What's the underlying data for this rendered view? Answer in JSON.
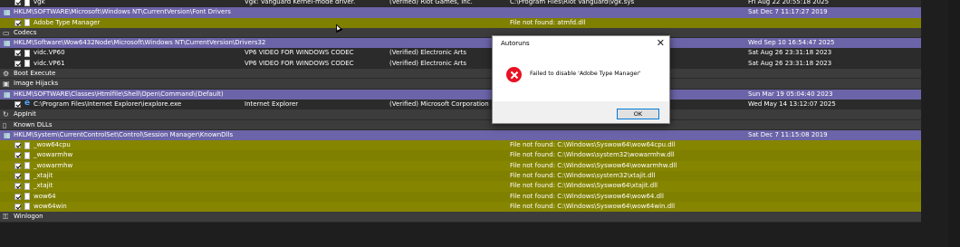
{
  "rows": [
    {
      "type": "entry",
      "icon": "file-icon",
      "name": "vgk",
      "desc": "Vgk: Vanguard Kernel-mode driver.",
      "pub": "(Verified) Riot Games, Inc.",
      "path": "C:\\Program Files\\Riot Vanguard\\vgk.sys",
      "time": "Fri Aug 22 20:55:18 2025"
    },
    {
      "type": "key",
      "name": "HKLM\\SOFTWARE\\Microsoft\\Windows NT\\CurrentVersion\\Font Drivers",
      "time": "Sat Dec  7 11:17:27 2019"
    },
    {
      "type": "nf",
      "name": "Adobe Type Manager",
      "path": "File not found: atmfd.dll"
    },
    {
      "type": "cat",
      "icon": "codecs-icon",
      "name": "Codecs"
    },
    {
      "type": "key",
      "name": "HKLM\\Software\\Wow6432Node\\Microsoft\\Windows NT\\CurrentVersion\\Drivers32",
      "time": "Wed Sep 10 16:54:47 2025"
    },
    {
      "type": "entry",
      "name": "vidc.VP60",
      "desc": "VP6 VIDEO FOR WINDOWS CODEC",
      "pub": "(Verified) Electronic Arts",
      "time": "Sat Aug 26 23:31:18 2023"
    },
    {
      "type": "entry",
      "name": "vidc.VP61",
      "desc": "VP6 VIDEO FOR WINDOWS CODEC",
      "pub": "(Verified) Electronic Arts",
      "time": "Sat Aug 26 23:31:18 2023"
    },
    {
      "type": "cat",
      "icon": "boot-execute-icon",
      "name": "Boot Execute"
    },
    {
      "type": "cat",
      "icon": "image-hijacks-icon",
      "name": "Image Hijacks"
    },
    {
      "type": "key",
      "name": "HKLM\\SOFTWARE\\Classes\\Htmlfile\\Shell\\Open\\Command\\(Default)",
      "time": "Sun Mar 19 05:04:40 2023"
    },
    {
      "type": "entry",
      "ie": true,
      "name": "C:\\Program Files\\Internet Explorer\\iexplore.exe",
      "desc": "Internet Explorer",
      "pub": "(Verified) Microsoft Corporation",
      "time": "Wed May 14 13:12:07 2025"
    },
    {
      "type": "cat",
      "icon": "appinit-icon",
      "name": "AppInit"
    },
    {
      "type": "cat",
      "icon": "known-dlls-icon",
      "name": "Known DLLs"
    },
    {
      "type": "key",
      "name": "HKLM\\System\\CurrentControlSet\\Control\\Session Manager\\KnownDlls",
      "time": "Sat Dec  7 11:15:08 2019"
    },
    {
      "type": "nf",
      "name": "_wow64cpu",
      "path": "File not found: C:\\Windows\\Syswow64\\wow64cpu.dll"
    },
    {
      "type": "nf",
      "name": "_wowarmhw",
      "path": "File not found: C:\\Windows\\system32\\wowarmhw.dll"
    },
    {
      "type": "nf",
      "name": "_wowarmhw",
      "path": "File not found: C:\\Windows\\Syswow64\\wowarmhw.dll"
    },
    {
      "type": "nf",
      "name": "_xtajit",
      "path": "File not found: C:\\Windows\\system32\\xtajit.dll"
    },
    {
      "type": "nf",
      "name": "_xtajit",
      "path": "File not found: C:\\Windows\\Syswow64\\xtajit.dll"
    },
    {
      "type": "nf",
      "name": "wow64",
      "path": "File not found: C:\\Windows\\Syswow64\\wow64.dll"
    },
    {
      "type": "nf",
      "name": "wow64win",
      "path": "File not found: C:\\Windows\\Syswow64\\wow64win.dll"
    },
    {
      "type": "cat",
      "icon": "winlogon-icon",
      "name": "Winlogon"
    }
  ],
  "dialog": {
    "title": "Autoruns",
    "message": "Failed to disable 'Adobe Type Manager'",
    "ok_label": "OK",
    "close_glyph": "✕"
  },
  "colors": {
    "key_row": "#6b64a8",
    "not_found_row": "#808000",
    "background": "#1e1e1e"
  }
}
